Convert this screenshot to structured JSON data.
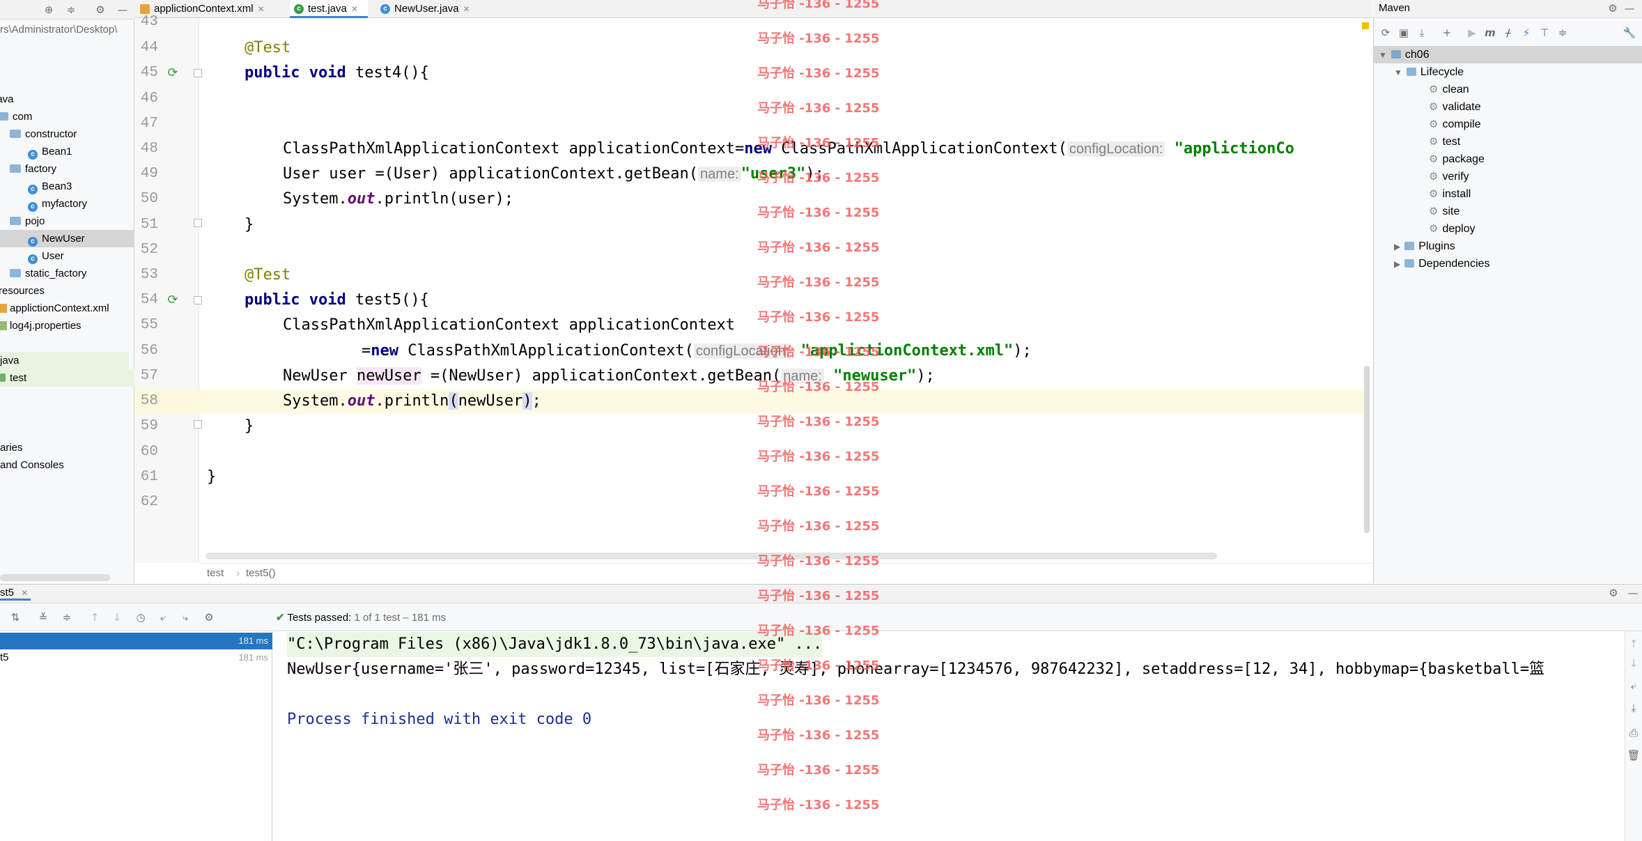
{
  "project": {
    "path_fragment": "rs\\Administrator\\Desktop\\",
    "items": [
      {
        "label": "java",
        "kind": "folder"
      },
      {
        "label": "com",
        "kind": "folder"
      },
      {
        "label": "constructor",
        "kind": "folder"
      },
      {
        "label": "Bean1",
        "kind": "class"
      },
      {
        "label": "factory",
        "kind": "folder"
      },
      {
        "label": "Bean3",
        "kind": "class"
      },
      {
        "label": "myfactory",
        "kind": "class"
      },
      {
        "label": "pojo",
        "kind": "folder"
      },
      {
        "label": "NewUser",
        "kind": "class"
      },
      {
        "label": "User",
        "kind": "class"
      },
      {
        "label": "static_factory",
        "kind": "folder"
      },
      {
        "label": "resources",
        "kind": "folder"
      },
      {
        "label": "applictionContext.xml",
        "kind": "xml"
      },
      {
        "label": "log4j.properties",
        "kind": "file"
      },
      {
        "label": "java",
        "kind": "folder"
      },
      {
        "label": "test",
        "kind": "test"
      },
      {
        "label": "aries",
        "kind": "text"
      },
      {
        "label": "and Consoles",
        "kind": "text"
      }
    ]
  },
  "tabs": [
    {
      "label": "applictionContext.xml",
      "active": false
    },
    {
      "label": "test.java",
      "active": true
    },
    {
      "label": "NewUser.java",
      "active": false
    }
  ],
  "editor": {
    "line_numbers": [
      "43",
      "44",
      "45",
      "46",
      "47",
      "48",
      "49",
      "50",
      "51",
      "52",
      "53",
      "54",
      "55",
      "56",
      "57",
      "58",
      "59",
      "60",
      "61",
      "62"
    ],
    "lines": {
      "l44_ann": "@Test",
      "l45_kw": "public void",
      "l45_rest": " test4(){",
      "l48_a": "ClassPathXmlApplicationContext applicationContext=",
      "l48_kw": "new",
      "l48_b": " ClassPathXmlApplicationContext(",
      "l48_hint": "configLocation:",
      "l48_str": "\"applictionCo",
      "l49_a": "User user =(User) applicationContext.getBean(",
      "l49_hint": "name:",
      "l49_str": "\"user3\"",
      "l49_end": ");",
      "l50_a": "System.",
      "l50_it": "out",
      "l50_b": ".println(user);",
      "l51": "}",
      "l53_ann": "@Test",
      "l54_kw": "public void",
      "l54_rest": " test5(){",
      "l55": "ClassPathXmlApplicationContext applicationContext",
      "l56_a": "=",
      "l56_kw": "new",
      "l56_b": " ClassPathXmlApplicationContext(",
      "l56_hint": "configLocation:",
      "l56_str": "\"applictionContext.xml\"",
      "l56_end": ");",
      "l57_a": "NewUser ",
      "l57_var": "newUser",
      "l57_b": " =(NewUser) applicationContext.getBean(",
      "l57_hint": "name:",
      "l57_str": "\"newuser\"",
      "l57_end": ");",
      "l58_a": "System.",
      "l58_it": "out",
      "l58_b": ".println",
      "l58_p1": "(",
      "l58_mid": "newUser",
      "l58_p2": ")",
      "l58_end": ";",
      "l59": "}",
      "l61": "}"
    },
    "breadcrumb": [
      "test",
      "test5()"
    ]
  },
  "maven": {
    "title": "Maven",
    "project": "ch06",
    "lifecycle_label": "Lifecycle",
    "goals": [
      "clean",
      "validate",
      "compile",
      "test",
      "package",
      "verify",
      "install",
      "site",
      "deploy"
    ],
    "plugins_label": "Plugins",
    "dependencies_label": "Dependencies"
  },
  "run": {
    "tab_label": "st5",
    "status": "Tests passed:",
    "status_detail": "1 of 1 test – 181 ms",
    "tests": [
      {
        "label": "",
        "time": "181 ms",
        "selected": true
      },
      {
        "label": "t5",
        "time": "181 ms",
        "selected": false
      }
    ],
    "console": {
      "cmd": "\"C:\\Program Files (x86)\\Java\\jdk1.8.0_73\\bin\\java.exe\" ...",
      "output": "NewUser{username='张三', password=12345, list=[石家庄, 灵寿], phonearray=[1234576, 987642232], setaddress=[12, 34], hobbymap={basketball=篮",
      "exit": "Process finished with exit code 0"
    }
  },
  "watermark": "马子怡 -136 - 1255",
  "colors": {
    "keyword": "#000080",
    "string": "#008000",
    "annotation": "#808000",
    "selection": "#2675bf",
    "watermark": "#f06060"
  }
}
